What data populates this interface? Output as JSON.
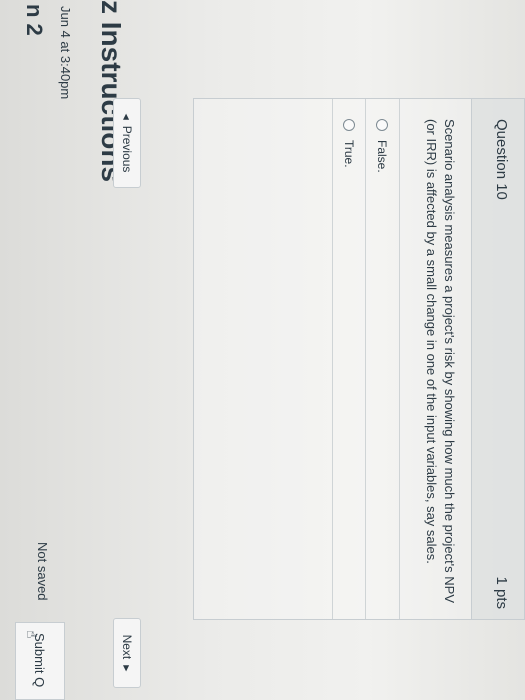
{
  "quiz": {
    "title_partial": "n 2",
    "due": "Jun 4 at 3:40pm",
    "instructions_heading": "z Instructions"
  },
  "question": {
    "title": "Question 10",
    "points": "1 pts",
    "text": "Scenario analysis measures a project's risk by showing how much the project's NPV (or IRR) is affected by a small change in one of the input variables, say sales.",
    "answers": [
      {
        "label": "False."
      },
      {
        "label": "True."
      }
    ]
  },
  "nav": {
    "previous_label": "Previous",
    "next_label": "Next",
    "previous_caret": "◀",
    "next_caret": "▶"
  },
  "footer": {
    "status": "Not saved",
    "submit_label": "Submit Q"
  },
  "icons": {
    "hand_cursor": "☝"
  }
}
